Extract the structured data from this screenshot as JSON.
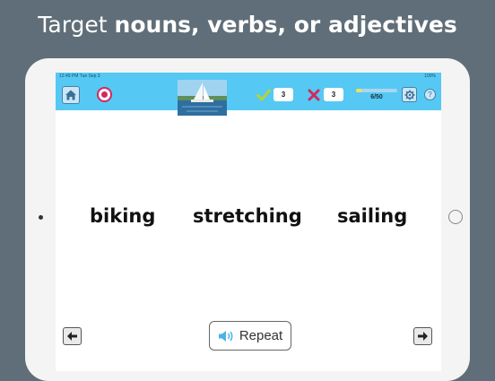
{
  "headline": {
    "prefix": "Target ",
    "emphasis": "nouns, verbs, or adjectives"
  },
  "statusbar": {
    "time": "12:49 PM   Tue Sep 3",
    "battery": "100%"
  },
  "toolbar": {
    "correct_count": "3",
    "incorrect_count": "3",
    "progress_label": "6/50",
    "progress_fraction": 0.12,
    "help_label": "?"
  },
  "words": [
    "biking",
    "stretching",
    "sailing"
  ],
  "footer": {
    "repeat_label": "Repeat"
  },
  "colors": {
    "toolbar": "#55c8f3",
    "check": "#b6d33a",
    "cross": "#d1295f",
    "record": "#d1295f",
    "background": "#5f6e78"
  },
  "icons": [
    "home-icon",
    "record-icon",
    "check-icon",
    "cross-icon",
    "gear-icon",
    "help-icon",
    "speaker-icon",
    "arrow-left-icon",
    "arrow-right-icon"
  ]
}
